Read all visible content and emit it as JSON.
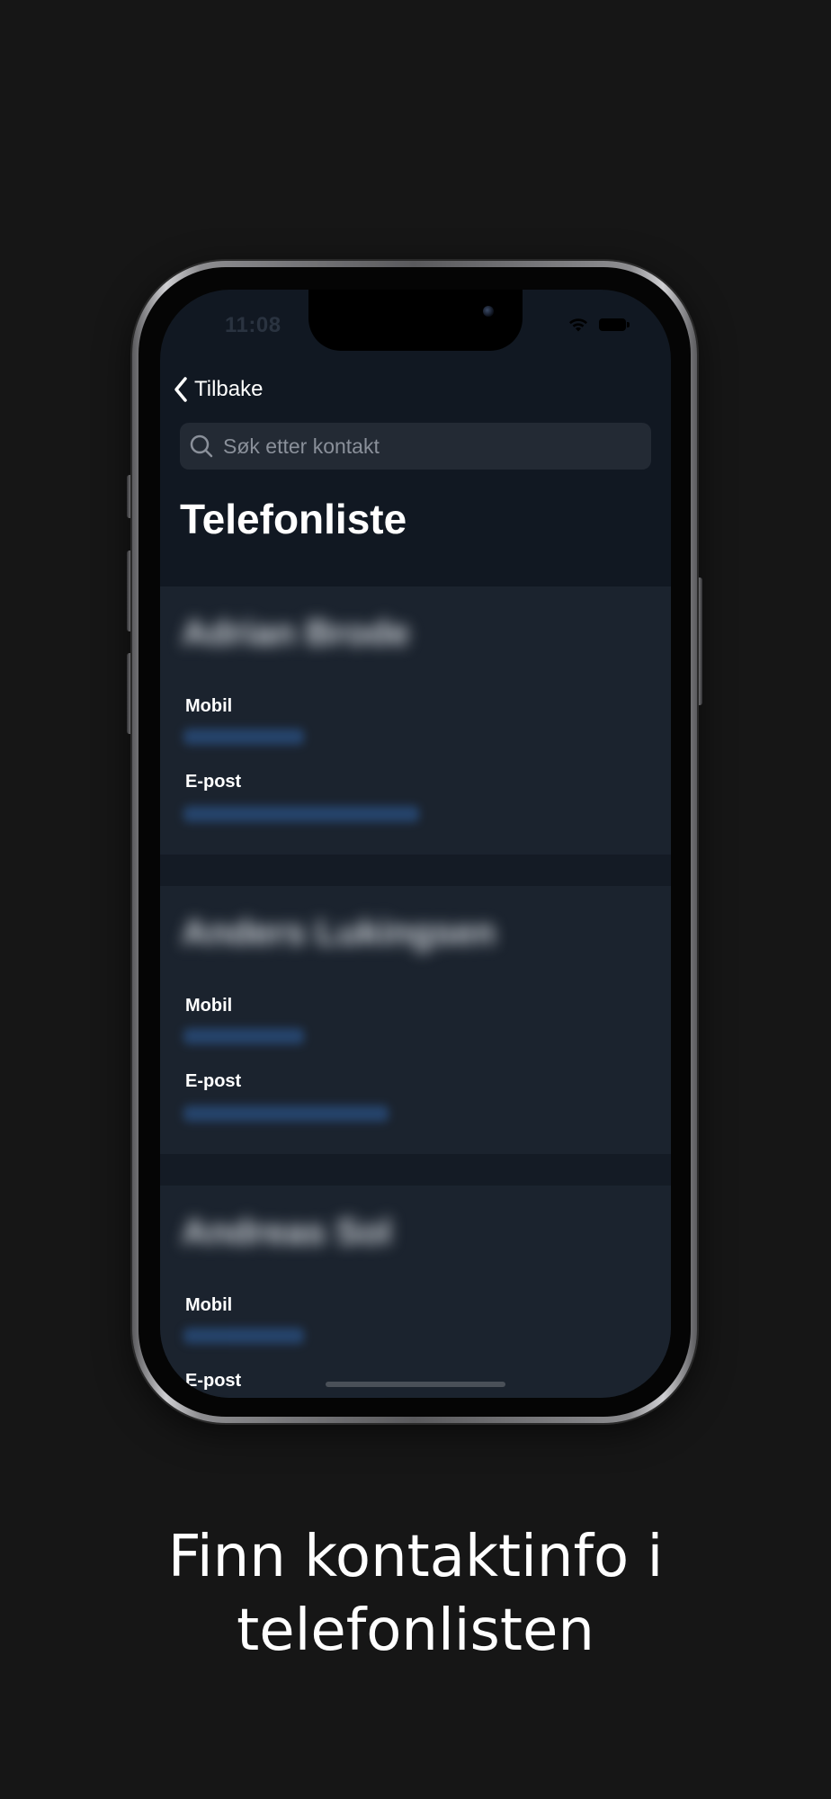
{
  "status_bar": {
    "time": "11:08"
  },
  "nav": {
    "back_label": "Tilbake"
  },
  "search": {
    "placeholder": "Søk etter kontakt",
    "value": ""
  },
  "page": {
    "title": "Telefonliste"
  },
  "contacts": [
    {
      "name": "Adrian Brode",
      "mobile_label": "Mobil",
      "mobile_value": "",
      "email_label": "E-post",
      "email_value": ""
    },
    {
      "name": "Anders Lukingsen",
      "mobile_label": "Mobil",
      "mobile_value": "",
      "email_label": "E-post",
      "email_value": ""
    },
    {
      "name": "Andreas Sol",
      "mobile_label": "Mobil",
      "mobile_value": "",
      "email_label": "E-post",
      "email_value": ""
    }
  ],
  "caption": {
    "line1": "Finn kontaktinfo i",
    "line2": "telefonlisten"
  },
  "colors": {
    "background": "#161616",
    "screen": "#111822",
    "card": "#1b232e",
    "link": "#2f5f9e"
  }
}
